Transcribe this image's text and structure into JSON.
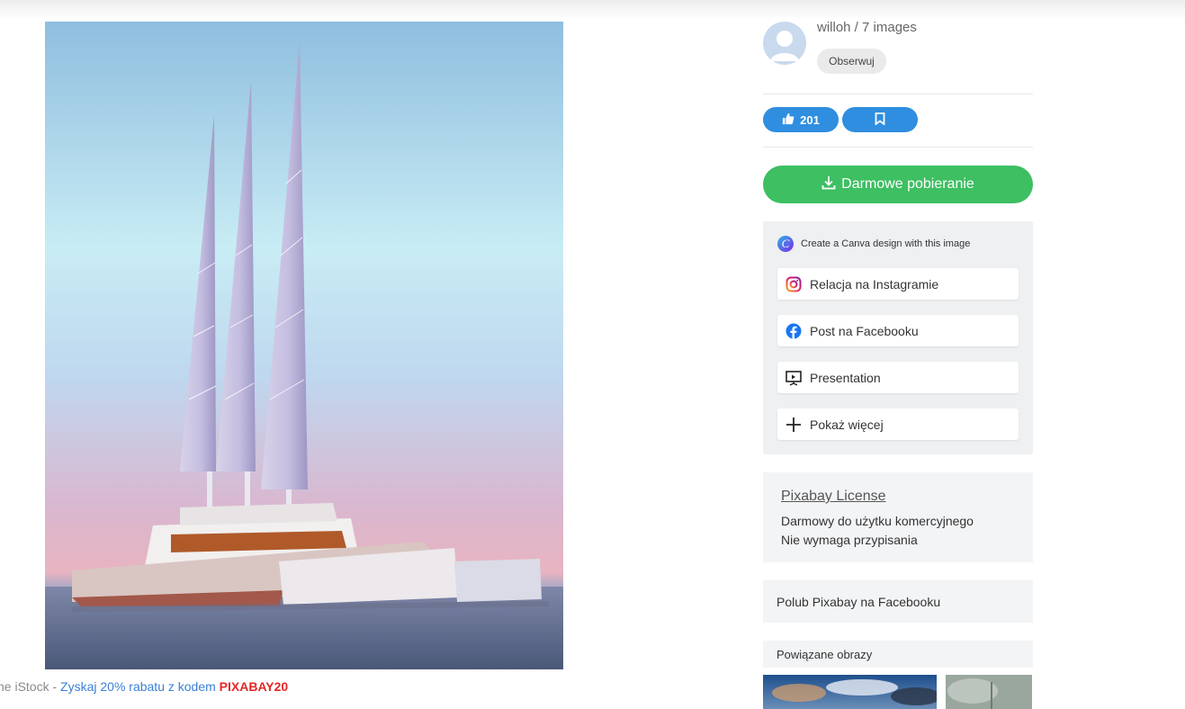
{
  "image": {
    "alt": "Trimaran sailing yacht with three tall sails at sea"
  },
  "promo": {
    "prefix": "ne iStock - ",
    "link_text": "Zyskaj 20% rabatu z kodem",
    "code": "PIXABAY20"
  },
  "author": {
    "name_line": "willoh / 7 images",
    "follow_label": "Obserwuj"
  },
  "actions": {
    "like_count": "201",
    "like_icon": "thumbs-up-icon",
    "bookmark_icon": "bookmark-icon"
  },
  "download": {
    "label": "Darmowe pobieranie",
    "icon": "download-icon"
  },
  "canva": {
    "heading": "Create a Canva design with this image",
    "items": [
      {
        "label": "Relacja na Instagramie",
        "icon": "instagram-icon"
      },
      {
        "label": "Post na Facebooku",
        "icon": "facebook-icon"
      },
      {
        "label": "Presentation",
        "icon": "presentation-icon"
      },
      {
        "label": "Pokaż więcej",
        "icon": "plus-icon"
      }
    ]
  },
  "license": {
    "title": "Pixabay License",
    "lines": [
      "Darmowy do użytku komercyjnego",
      "Nie wymaga przypisania"
    ]
  },
  "facebook_promo": "Polub Pixabay na Facebooku",
  "related": {
    "heading": "Powiązane obrazy"
  },
  "colors": {
    "accent_blue": "#2f8ee0",
    "download_green": "#3dbf62",
    "promo_code_red": "#e32727"
  }
}
